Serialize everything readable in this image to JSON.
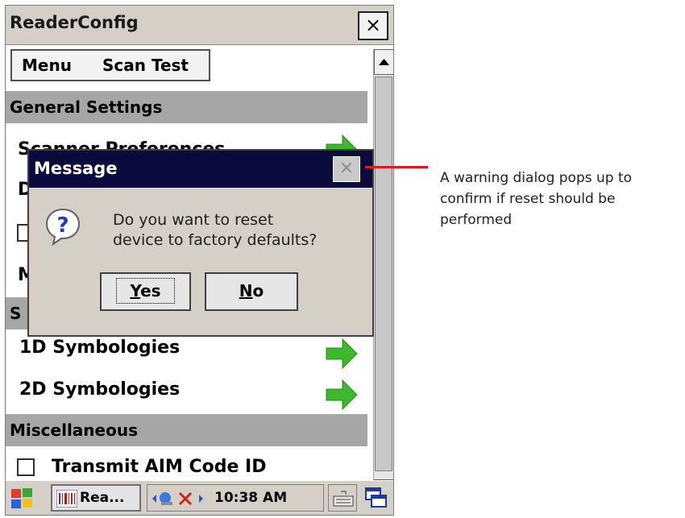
{
  "window": {
    "title": "ReaderConfig",
    "close_label": "×"
  },
  "menubar": {
    "menu": "Menu",
    "scan_test": "Scan Test"
  },
  "sections": {
    "general": "General Settings",
    "symbologies_partial": "S",
    "misc": "Miscellaneous"
  },
  "rows": {
    "scanner_prefs": "Scanner Preferences",
    "row_d_partial": "D",
    "row_m_partial": "M",
    "sym_1d": "1D Symbologies",
    "sym_2d": "2D Symbologies",
    "transmit_aim": "Transmit AIM Code ID"
  },
  "dialog": {
    "title": "Message",
    "close_label": "×",
    "message_line1": "Do you want to reset",
    "message_line2": "device to factory defaults?",
    "yes_mnemonic": "Y",
    "yes_rest": "es",
    "no_mnemonic": "N",
    "no_rest": "o"
  },
  "taskbar": {
    "app_label": "Rea...",
    "time": "10:38 AM"
  },
  "callout": {
    "text": "A warning dialog pops up to confirm if reset should be performed"
  },
  "colors": {
    "arrow_green": "#3cb82c",
    "callout_red": "#e01a24",
    "dialog_title_bg": "#0a0a3c"
  }
}
